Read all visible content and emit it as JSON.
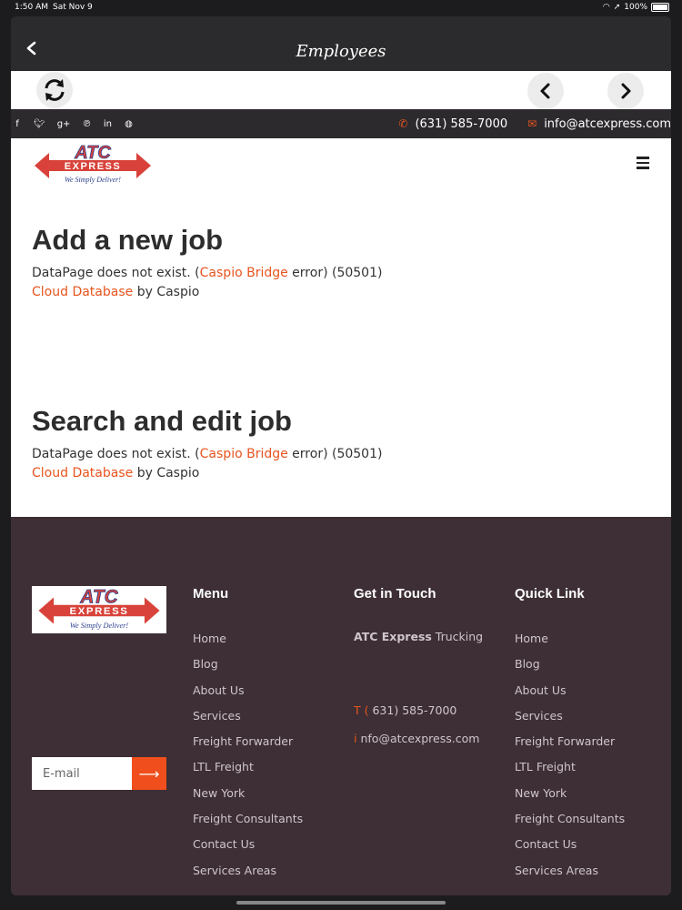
{
  "status": {
    "time": "1:50 AM",
    "date": "Sat Nov 9",
    "battery": "100%"
  },
  "nav": {
    "title": "Employees"
  },
  "topbar": {
    "social_icons": [
      "facebook-icon",
      "twitter-icon",
      "google-plus-icon",
      "pinterest-icon",
      "linkedin-icon",
      "dribbble-icon"
    ],
    "phone": "(631) 585-7000",
    "email": "info@atcexpress.com"
  },
  "logo": {
    "brand": "ATC",
    "sub": "EXPRESS",
    "tagline": "We Simply Deliver!"
  },
  "sections": [
    {
      "heading": "Add a new job",
      "error_prefix": "DataPage does not exist. (",
      "error_link": "Caspio Bridge",
      "error_suffix": " error) (50501)",
      "credit_link": "Cloud Database",
      "credit_suffix": " by Caspio"
    },
    {
      "heading": "Search and edit job",
      "error_prefix": "DataPage does not exist. (",
      "error_link": "Caspio Bridge",
      "error_suffix": " error) (50501)",
      "credit_link": "Cloud Database",
      "credit_suffix": " by Caspio"
    }
  ],
  "footer": {
    "email_placeholder": "E-mail",
    "menu": {
      "title": "Menu",
      "items": [
        "Home",
        "Blog",
        "About Us",
        "Services",
        "Freight Forwarder",
        "LTL Freight",
        "New York",
        "Freight Consultants",
        "Contact Us",
        "Services Areas"
      ]
    },
    "touch": {
      "title": "Get in Touch",
      "company_bold": "ATC Express",
      "company_rest": " Trucking",
      "phone_prefix": "T (",
      "phone": "631) 585-7000",
      "email_prefix": "i",
      "email": "nfo@atcexpress.com"
    },
    "quick": {
      "title": "Quick Link",
      "items": [
        "Home",
        "Blog",
        "About Us",
        "Services",
        "Freight Forwarder",
        "LTL Freight",
        "New York",
        "Freight Consultants",
        "Contact Us",
        "Services Areas"
      ]
    }
  },
  "colors": {
    "accent": "#e8541e",
    "footer_bg": "#3d2f35",
    "topbar_bg": "#2d2a2e"
  }
}
